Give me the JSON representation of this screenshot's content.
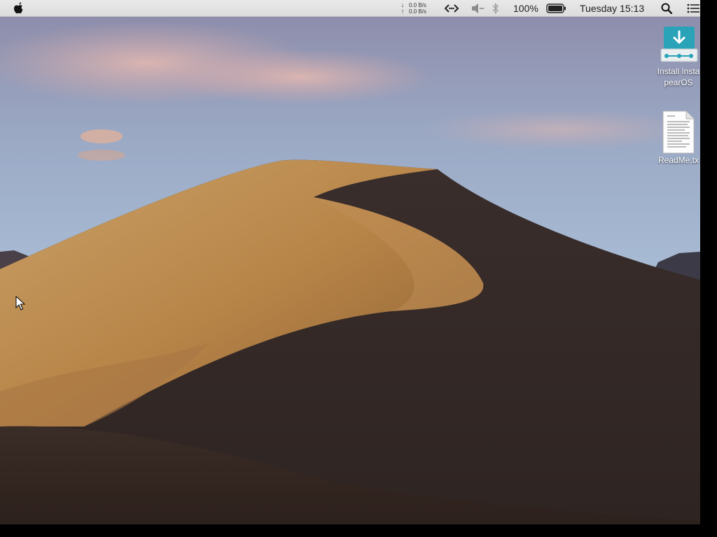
{
  "menubar": {
    "apple_icon": "apple-logo-icon",
    "network": {
      "down_rate": "0.0 B/s",
      "up_rate": "0.0 B/s",
      "down_arrow": "↓",
      "up_arrow": "↑"
    },
    "remote_icon": "remote-code-icon",
    "volume_icon": "speaker-muted-icon",
    "bluetooth_icon": "bluetooth-icon",
    "battery_percent": "100%",
    "battery_icon": "battery-full-icon",
    "clock": "Tuesday 15:13",
    "spotlight_icon": "search-icon",
    "notifications_icon": "list-icon"
  },
  "desktop": {
    "icons": [
      {
        "label_line1": "Install Insta",
        "label_line2": "pearOS",
        "icon": "download-installer-icon",
        "accent": "#2aa3b8"
      },
      {
        "label": "ReadMe.tx",
        "icon": "text-document-icon"
      }
    ]
  }
}
